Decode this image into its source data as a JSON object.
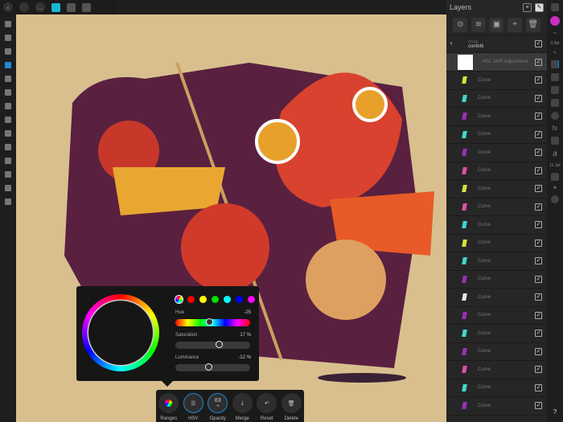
{
  "topbar": {
    "icons": [
      "back-icon",
      "document-icon",
      "more-icon",
      "persona-designer-icon",
      "persona-pixel-icon",
      "persona-export-icon"
    ]
  },
  "layers": {
    "title": "Layers",
    "group": {
      "label": "Group",
      "name": "confetti"
    },
    "adjustment": "HSL Shift Adjustment",
    "curves": [
      {
        "label": "Curve",
        "color": "#d8e23a"
      },
      {
        "label": "Curve",
        "color": "#3fd7d0"
      },
      {
        "label": "Curve",
        "color": "#9a2fb5"
      },
      {
        "label": "Curve",
        "color": "#3fd7d0"
      },
      {
        "label": "Curve",
        "color": "#9a2fb5"
      },
      {
        "label": "Curve",
        "color": "#e04fa8"
      },
      {
        "label": "Curve",
        "color": "#d8e23a"
      },
      {
        "label": "Curve",
        "color": "#e04fa8"
      },
      {
        "label": "Curve",
        "color": "#3fd7d0"
      },
      {
        "label": "Curve",
        "color": "#d8e23a"
      },
      {
        "label": "Curve",
        "color": "#3fd7d0"
      },
      {
        "label": "Curve",
        "color": "#9a2fb5"
      },
      {
        "label": "Curve",
        "color": "#e8e8e8"
      },
      {
        "label": "Curve",
        "color": "#9a2fb5"
      },
      {
        "label": "Curve",
        "color": "#3fd7d0"
      },
      {
        "label": "Curve",
        "color": "#9a2fb5"
      },
      {
        "label": "Curve",
        "color": "#e04fa8"
      },
      {
        "label": "Curve",
        "color": "#3fd7d0"
      },
      {
        "label": "Curve",
        "color": "#9a2fb5"
      }
    ]
  },
  "rightstrip": {
    "brush_color": "#c92fc2",
    "stroke_width": "3.5pt",
    "font_size": "11.1pt",
    "help": "?"
  },
  "hsl": {
    "swatches": [
      "#ff0000",
      "#ffff00",
      "#00dd00",
      "#00ffff",
      "#0000ff",
      "#ff00ff"
    ],
    "hue": {
      "label": "Hue",
      "value": "-25",
      "fraction": 0.45
    },
    "saturation": {
      "label": "Saturation",
      "value": "17 %",
      "fraction": 0.58
    },
    "luminance": {
      "label": "Luminance",
      "value": "-12 %",
      "fraction": 0.44
    }
  },
  "bottombar": {
    "ranges": "Ranges",
    "hsv": "HSV",
    "opacity": "Opacity",
    "opacity_value": "83",
    "opacity_unit": "%",
    "merge": "Merge",
    "reset": "Reset",
    "delete": "Delete"
  }
}
